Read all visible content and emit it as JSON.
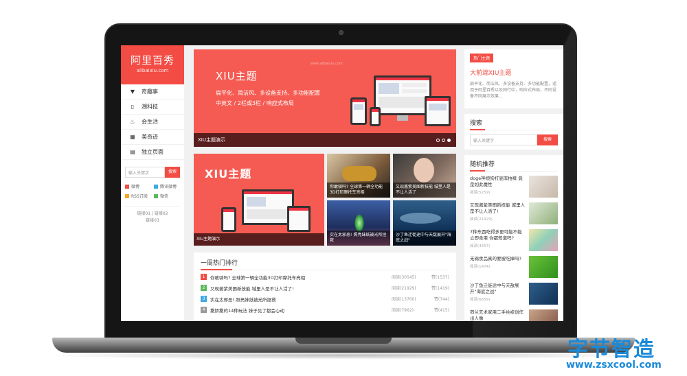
{
  "sidebar": {
    "brand_name": "阿里百秀",
    "brand_domain": "alibaixiu.com",
    "nav": [
      {
        "label": "奇趣事",
        "icon": "funnel-icon"
      },
      {
        "label": "潮科技",
        "icon": "phone-icon"
      },
      {
        "label": "会生活",
        "icon": "flame-icon"
      },
      {
        "label": "美奇迹",
        "icon": "grid-icon"
      },
      {
        "label": "独立页面",
        "icon": "list-icon"
      }
    ],
    "search_placeholder": "输入关键字",
    "search_button": "搜索",
    "tags": [
      {
        "label": "微博",
        "color": "#f24c44"
      },
      {
        "label": "腾讯微博",
        "color": "#3fa9e0"
      },
      {
        "label": "RSS订阅",
        "color": "#f5a623"
      },
      {
        "label": "微信",
        "color": "#5cb85c"
      }
    ],
    "links_line1": "链接01 | 链接02",
    "links_line2": "链接03"
  },
  "hero": {
    "title": "XIU主题",
    "sub1": "扁平化、简洁风、多设备支持、多功能配置",
    "sub2": "中英文 / 2栏或3栏 / 响应式布局",
    "watermark": "www.alibaixiu.com",
    "caption": "XIU主题演示"
  },
  "banner2": {
    "title": "XIU主题",
    "caption": "XIU主题演示"
  },
  "tiles": [
    {
      "caption": "你敢骑吗? 全球第一辆全功能3D打印摩托车亮相"
    },
    {
      "caption": "又现酱紫美图新技能 城里人是不让人活了"
    },
    {
      "caption": "实在太邪恶! 照亮妹纸被光所拯救"
    },
    {
      "caption": "沙丁鱼迁徙途中与天敌展开\"海底之战\""
    }
  ],
  "hot": {
    "title": "一周热门排行",
    "rows": [
      {
        "num": "1",
        "color": "#f24c44",
        "title": "你敢骑吗? 全球第一辆全功能3D打印摩托车亮相",
        "views": "阅读(30545)",
        "likes": "赞(1537)"
      },
      {
        "num": "2",
        "color": "#5cb85c",
        "title": "又现酱紫美图新技能 城里人是不让人活了!",
        "views": "阅读(21929)",
        "likes": "赞(1419)"
      },
      {
        "num": "3",
        "color": "#3fa9e0",
        "title": "实在太邪恶! 照亮妹纸被光所拯救",
        "views": "阅读(13760)",
        "likes": "赞(744)"
      },
      {
        "num": "4",
        "color": "#999999",
        "title": "撒娇撒的14种玩法 妹子见了都会心动",
        "views": "阅读(7962)",
        "likes": "赞(415)"
      }
    ]
  },
  "right": {
    "hot_chip": "热门主题",
    "hot_title": "大前端XIU主题",
    "hot_desc": "扁平化、简洁风、多设备支持、多功能配置，适用于阿里百秀以及同行中，响应式布局，不同设备不同展示效果...",
    "search_title": "搜索",
    "search_placeholder": "输入关键字",
    "search_button": "搜索",
    "random_title": "随机推荐",
    "random": [
      {
        "title": "doge神烦狗打底库拍裤 竟是如此魔性",
        "views": "阅读(5259)"
      },
      {
        "title": "又现酱紫美图新技能 城里人是不让人活了!",
        "views": "阅读(21929)"
      },
      {
        "title": "7种东西吃得多更可能不能立即食用 你都知道吗?",
        "views": "阅读(4557)"
      },
      {
        "title": "无锡食品真的要被吃掉吗?",
        "views": "阅读(1474)"
      },
      {
        "title": "沙丁鱼迁徙途中与天敌展开\"海底之战\"",
        "views": "阅读(6659)"
      },
      {
        "title": "荷兰艺术家用二手丝袜创作出人像",
        "views": "阅读(1543)"
      }
    ]
  },
  "watermark": {
    "cn": "字节智造",
    "url": "www.zsxcool.com"
  }
}
